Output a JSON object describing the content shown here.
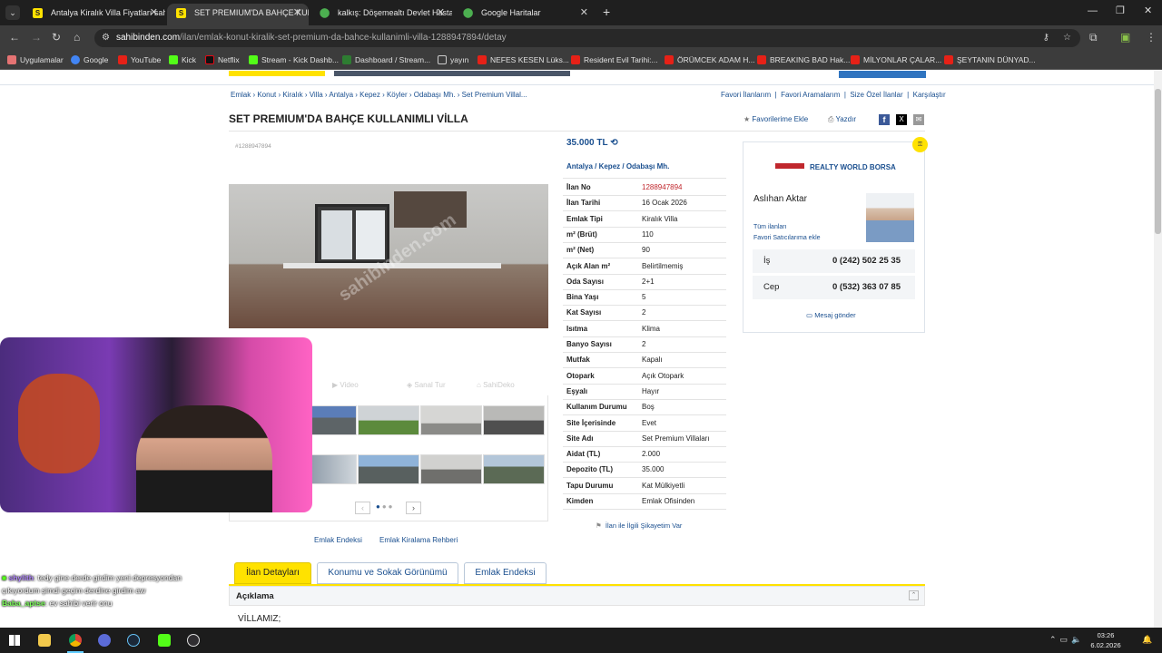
{
  "tabs": [
    {
      "label": "Antalya Kiralık Villa Fiyatları sahibinden",
      "icon": "sahibinden-favicon"
    },
    {
      "label": "SET PREMIUM'DA BAHÇE KULLANIMLI",
      "icon": "sahibinden-favicon"
    },
    {
      "label": "kalkış: Döşemealtı Devlet Hastanesi",
      "icon": "maps-pin-icon"
    },
    {
      "label": "Google Haritalar",
      "icon": "maps-pin-icon"
    }
  ],
  "address": {
    "domain": "sahibinden.com",
    "path": "/ilan/emlak-konut-kiralik-set-premium-da-bahce-kullanimli-villa-1288947894/detay"
  },
  "bookmarks": [
    "Uygulamalar",
    "Google",
    "YouTube",
    "Kick",
    "Netflix",
    "Stream - Kick Dashb...",
    "Dashboard / Stream...",
    "yayın",
    "NEFES KESEN Lüks...",
    "Resident Evil Tarihi:...",
    "ÖRÜMCEK ADAM H...",
    "BREAKING BAD Hak...",
    "MİLYONLAR ÇALAR...",
    "ŞEYTANIN DÜNYAD..."
  ],
  "breadcrumb": [
    "Emlak",
    "Konut",
    "Kiralık",
    "Villa",
    "Antalya",
    "Kepez",
    "Köyler",
    "Odabaşı Mh.",
    "Set Premium Villal..."
  ],
  "top_links": [
    "Favori İlanlarım",
    "Favori Aramalarım",
    "Size Özel İlanlar",
    "Karşılaştır"
  ],
  "listing": {
    "title": "SET PREMIUM'DA BAHÇE KULLANIMLI VİLLA",
    "id_small": "#1288947894",
    "price": "35.000 TL",
    "location": [
      "Antalya",
      "Kepez",
      "Odabaşı Mh."
    ],
    "actions": {
      "favorite": "Favorilerime Ekle",
      "print": "Yazdır"
    },
    "watermark": "sahibinden.com",
    "details": [
      [
        "İlan No",
        "1288947894"
      ],
      [
        "İlan Tarihi",
        "16 Ocak 2026"
      ],
      [
        "Emlak Tipi",
        "Kiralık Villa"
      ],
      [
        "m² (Brüt)",
        "110"
      ],
      [
        "m² (Net)",
        "90"
      ],
      [
        "Açık Alan m²",
        "Belirtilmemiş"
      ],
      [
        "Oda Sayısı",
        "2+1"
      ],
      [
        "Bina Yaşı",
        "5"
      ],
      [
        "Kat Sayısı",
        "2"
      ],
      [
        "Isıtma",
        "Klima"
      ],
      [
        "Banyo Sayısı",
        "2"
      ],
      [
        "Mutfak",
        "Kapalı"
      ],
      [
        "Otopark",
        "Açık Otopark"
      ],
      [
        "Eşyalı",
        "Hayır"
      ],
      [
        "Kullanım Durumu",
        "Boş"
      ],
      [
        "Site İçerisinde",
        "Evet"
      ],
      [
        "Site Adı",
        "Set Premium Villaları"
      ],
      [
        "Aidat (TL)",
        "2.000"
      ],
      [
        "Depozito (TL)",
        "35.000"
      ],
      [
        "Tapu Durumu",
        "Kat Mülkiyetli"
      ],
      [
        "Kimden",
        "Emlak Ofisinden"
      ]
    ],
    "complaint": "İlan ile İlgili Şikayetim Var",
    "media_tabs": [
      "Video",
      "Sanal Tur",
      "SahiDeko"
    ],
    "links": [
      "Emlak Endeksi",
      "Emlak Kiralama Rehberi"
    ]
  },
  "seller": {
    "agency": "REALTY WORLD BORSA",
    "name": "Aslıhan Aktar",
    "links": [
      "Tüm ilanları",
      "Favori Satıcılarıma ekle"
    ],
    "phones": [
      [
        "İş",
        "0 (242) 502 25 35"
      ],
      [
        "Cep",
        "0 (532) 363 07 85"
      ]
    ],
    "message": "Mesaj gönder"
  },
  "bottom_tabs": [
    "İlan Detayları",
    "Konumu ve Sokak Görünümü",
    "Emlak Endeksi"
  ],
  "description": {
    "heading": "Açıklama",
    "first_line": "VİLLAMIZ;"
  },
  "chat": [
    {
      "user": "shylith",
      "text": ": tedy gine derde girdim yeni depresyondan çıkıyordum şimdi geçim derdine girdim aw"
    },
    {
      "user": "Baba_aptse",
      "text": ": ev sahibi verir onu"
    }
  ],
  "clock": {
    "time": "03:26",
    "date": "6.02.2026"
  },
  "colors": {
    "accent_yellow": "#ffe200",
    "link_blue": "#1a4f8f",
    "id_red": "#c0272d"
  }
}
